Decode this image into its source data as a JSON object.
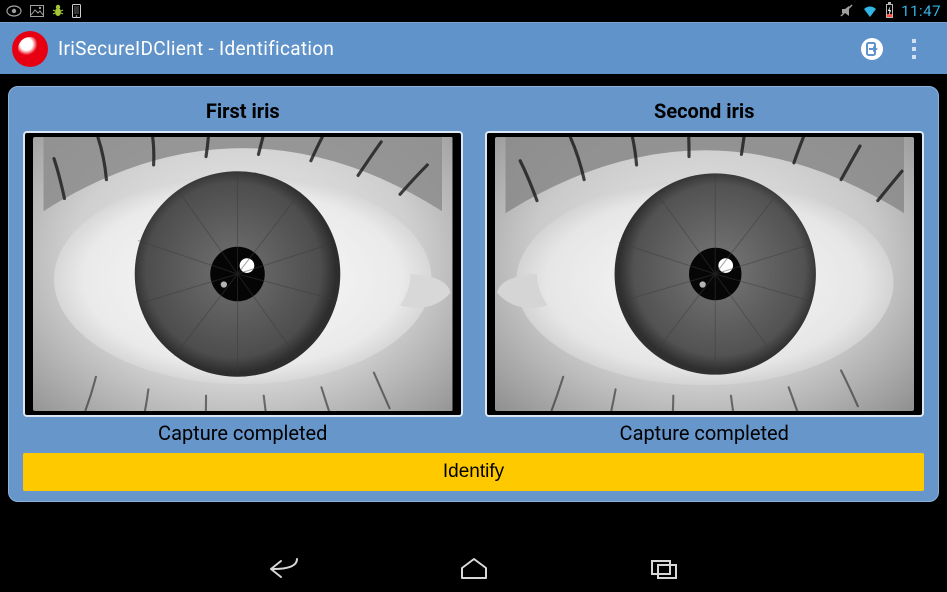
{
  "status": {
    "clock": "11:47"
  },
  "actionbar": {
    "title": "IriSecureIDClient - Identification"
  },
  "iris": {
    "first": {
      "label": "First iris",
      "status": "Capture completed"
    },
    "second": {
      "label": "Second iris",
      "status": "Capture completed"
    }
  },
  "identify_label": "Identify"
}
